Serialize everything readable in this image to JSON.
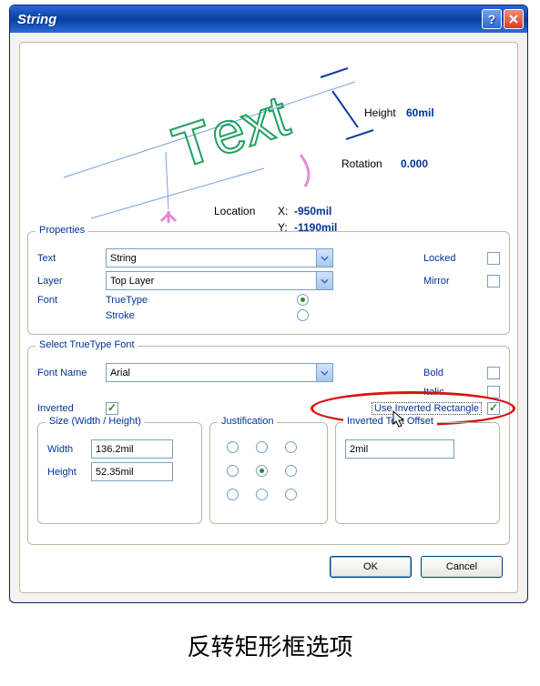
{
  "window": {
    "title": "String"
  },
  "preview": {
    "sample_text": "Text",
    "height_label": "Height",
    "height_value": "60mil",
    "rotation_label": "Rotation",
    "rotation_value": "0.000",
    "location_label": "Location",
    "x_label": "X:",
    "x_value": "-950mil",
    "y_label": "Y:",
    "y_value": "-1190mil"
  },
  "properties": {
    "group_label": "Properties",
    "text_label": "Text",
    "text_value": "String",
    "layer_label": "Layer",
    "layer_value": "Top Layer",
    "font_label": "Font",
    "truetype_label": "TrueType",
    "stroke_label": "Stroke",
    "font_selected": "TrueType",
    "locked_label": "Locked",
    "locked_checked": false,
    "mirror_label": "Mirror",
    "mirror_checked": false
  },
  "truetype": {
    "group_label": "Select TrueType Font",
    "fontname_label": "Font Name",
    "fontname_value": "Arial",
    "bold_label": "Bold",
    "bold_checked": false,
    "italic_label": "Italic",
    "italic_checked": false,
    "inverted_label": "Inverted",
    "inverted_checked": true,
    "use_rect_label": "Use Inverted Rectangle",
    "use_rect_checked": true,
    "size": {
      "group_label": "Size (Width / Height)",
      "width_label": "Width",
      "width_value": "136.2mil",
      "height_label": "Height",
      "height_value": "52.35mil"
    },
    "justification": {
      "group_label": "Justification",
      "selected_index": 4
    },
    "offset": {
      "group_label": "Inverted Text Offset",
      "value": "2mil"
    }
  },
  "buttons": {
    "ok": "OK",
    "cancel": "Cancel"
  },
  "caption": "反转矩形框选项"
}
